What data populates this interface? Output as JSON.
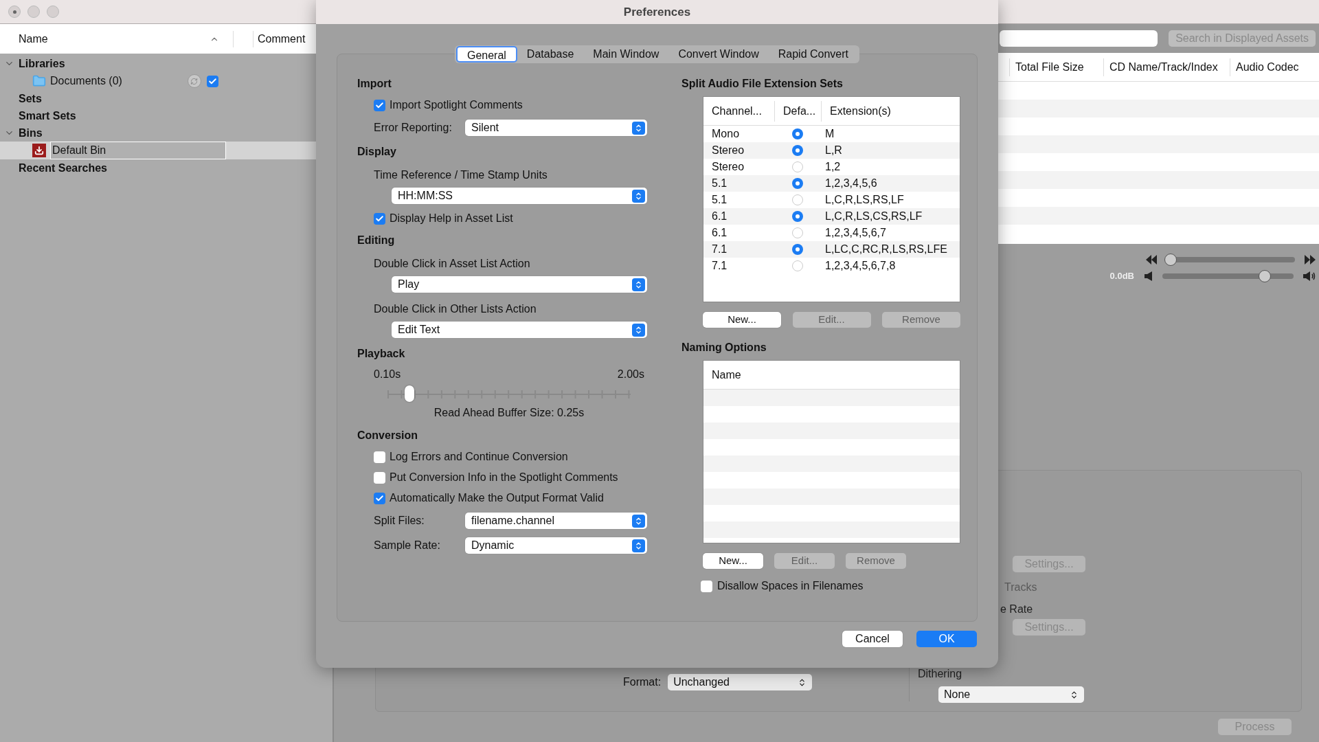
{
  "main_window": {
    "sidebar": {
      "columns": [
        "Name",
        "Comment"
      ],
      "tree": [
        {
          "label": "Libraries",
          "expanded": true,
          "children": [
            {
              "label": "Documents (0)",
              "selected": false,
              "checked": true
            }
          ]
        },
        {
          "label": "Sets"
        },
        {
          "label": "Smart Sets"
        },
        {
          "label": "Bins",
          "expanded": true,
          "children": [
            {
              "label": "Default Bin",
              "selected": true
            }
          ]
        },
        {
          "label": "Recent Searches"
        }
      ]
    },
    "search_button": "Search in Displayed Assets",
    "table_columns": [
      "Total File Size",
      "CD Name/Track/Index",
      "Audio Codec"
    ],
    "position_slider": {
      "level": 0.03
    },
    "volume_slider": {
      "reading": "0.0dB",
      "level": 0.78
    },
    "output": {
      "settings_buttons": [
        "Settings...",
        "Settings..."
      ],
      "tracks_label": "Tracks",
      "rate_label": "e Rate",
      "dithering_label": "Dithering",
      "dithering_value": "None",
      "format_label": "Format:",
      "format_value": "Unchanged"
    },
    "process_button": "Process"
  },
  "dialog": {
    "title": "Preferences",
    "tabs": [
      {
        "label": "General",
        "selected": true
      },
      {
        "label": "Database",
        "selected": false
      },
      {
        "label": "Main Window",
        "selected": false
      },
      {
        "label": "Convert Window",
        "selected": false
      },
      {
        "label": "Rapid Convert",
        "selected": false
      }
    ],
    "sections": [
      {
        "title": "Import",
        "items": [
          {
            "kind": "checkbox",
            "label": "Import Spotlight Comments",
            "checked": true
          },
          {
            "kind": "inline_select",
            "label": "Error Reporting:",
            "value": "Silent"
          }
        ]
      },
      {
        "title": "Display",
        "items": [
          {
            "kind": "caption",
            "text": "Time Reference / Time Stamp Units"
          },
          {
            "kind": "select",
            "value": "HH:MM:SS"
          },
          {
            "kind": "checkbox",
            "label": "Display Help in Asset List",
            "checked": true
          }
        ]
      },
      {
        "title": "Editing",
        "items": [
          {
            "kind": "caption",
            "text": "Double Click in Asset List Action"
          },
          {
            "kind": "select",
            "value": "Play"
          },
          {
            "kind": "caption",
            "text": "Double Click in Other Lists Action"
          },
          {
            "kind": "select",
            "value": "Edit Text"
          }
        ]
      },
      {
        "title": "Playback",
        "items": [
          {
            "kind": "slider",
            "min_label": "0.10s",
            "max_label": "2.00s",
            "level": 0.09,
            "caption": "Read Ahead Buffer Size: 0.25s"
          }
        ]
      },
      {
        "title": "Conversion",
        "items": [
          {
            "kind": "checkbox",
            "label": "Log Errors and Continue Conversion",
            "checked": false
          },
          {
            "kind": "checkbox",
            "label": "Put Conversion Info in the Spotlight Comments",
            "checked": false
          },
          {
            "kind": "checkbox",
            "label": "Automatically Make the Output Format Valid",
            "checked": true
          },
          {
            "kind": "inline_select",
            "label": "Split Files:",
            "value": "filename.channel"
          },
          {
            "kind": "inline_select",
            "label": "Sample Rate:",
            "value": "Dynamic"
          }
        ]
      }
    ],
    "extension_sets": {
      "title": "Split Audio File Extension Sets",
      "columns": [
        "Channel...",
        "Defa...",
        "Extension(s)"
      ],
      "rows": [
        {
          "channel": "Mono",
          "default": true,
          "extensions": "M"
        },
        {
          "channel": "Stereo",
          "default": true,
          "extensions": "L,R"
        },
        {
          "channel": "Stereo",
          "default": false,
          "extensions": "1,2"
        },
        {
          "channel": "5.1",
          "default": true,
          "extensions": "1,2,3,4,5,6"
        },
        {
          "channel": "5.1",
          "default": false,
          "extensions": "L,C,R,LS,RS,LF"
        },
        {
          "channel": "6.1",
          "default": true,
          "extensions": "L,C,R,LS,CS,RS,LF"
        },
        {
          "channel": "6.1",
          "default": false,
          "extensions": "1,2,3,4,5,6,7"
        },
        {
          "channel": "7.1",
          "default": true,
          "extensions": "L,LC,C,RC,R,LS,RS,LFE"
        },
        {
          "channel": "7.1",
          "default": false,
          "extensions": "1,2,3,4,5,6,7,8"
        }
      ],
      "buttons": [
        {
          "label": "New...",
          "disabled": false
        },
        {
          "label": "Edit...",
          "disabled": true
        },
        {
          "label": "Remove",
          "disabled": true
        }
      ]
    },
    "naming_options": {
      "title": "Naming Options",
      "columns": [
        "Name"
      ],
      "buttons": [
        {
          "label": "New...",
          "disabled": false
        },
        {
          "label": "Edit...",
          "disabled": true
        },
        {
          "label": "Remove",
          "disabled": true
        }
      ],
      "checkbox": {
        "label": "Disallow Spaces in Filenames",
        "checked": false
      }
    },
    "footer_buttons": [
      {
        "label": "Cancel",
        "primary": false
      },
      {
        "label": "OK",
        "primary": true
      }
    ]
  }
}
